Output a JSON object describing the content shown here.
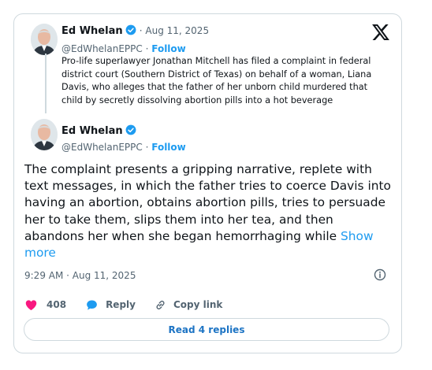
{
  "quoted_tweet": {
    "author_name": "Ed Whelan",
    "date": "Aug 11, 2025",
    "handle": "@EdWhelanEPPC",
    "follow_label": "Follow",
    "text": "Pro-life superlawyer Jonathan Mitchell has filed a complaint in federal district court (Southern District of Texas) on behalf of a woman, Liana Davis, who alleges that the father of her unborn child murdered that child by secretly dissolving abortion pills into a hot beverage"
  },
  "main_tweet": {
    "author_name": "Ed Whelan",
    "handle": "@EdWhelanEPPC",
    "follow_label": "Follow",
    "text": "The complaint presents a gripping narrative, replete with text messages, in which the father tries to coerce Davis into having an abortion, obtains abortion pills, tries to persuade her to take them, slips them into her tea, and then abandons her when she began hemorrhaging while",
    "show_more_label": "Show more",
    "timestamp": "9:29 AM · Aug 11, 2025"
  },
  "actions": {
    "likes_count": "408",
    "reply_label": "Reply",
    "copy_link_label": "Copy link"
  },
  "read_replies_label": "Read 4 replies",
  "icons": {
    "verified": "verified-badge-icon",
    "x_logo": "x-logo-icon",
    "info": "info-icon",
    "like": "heart-icon",
    "reply": "speech-bubble-icon",
    "copy_link": "link-icon"
  },
  "colors": {
    "accent": "#1d9bf0",
    "like": "#f91880",
    "text": "#0f1419",
    "secondary": "#536471",
    "border": "#cfd9de"
  }
}
